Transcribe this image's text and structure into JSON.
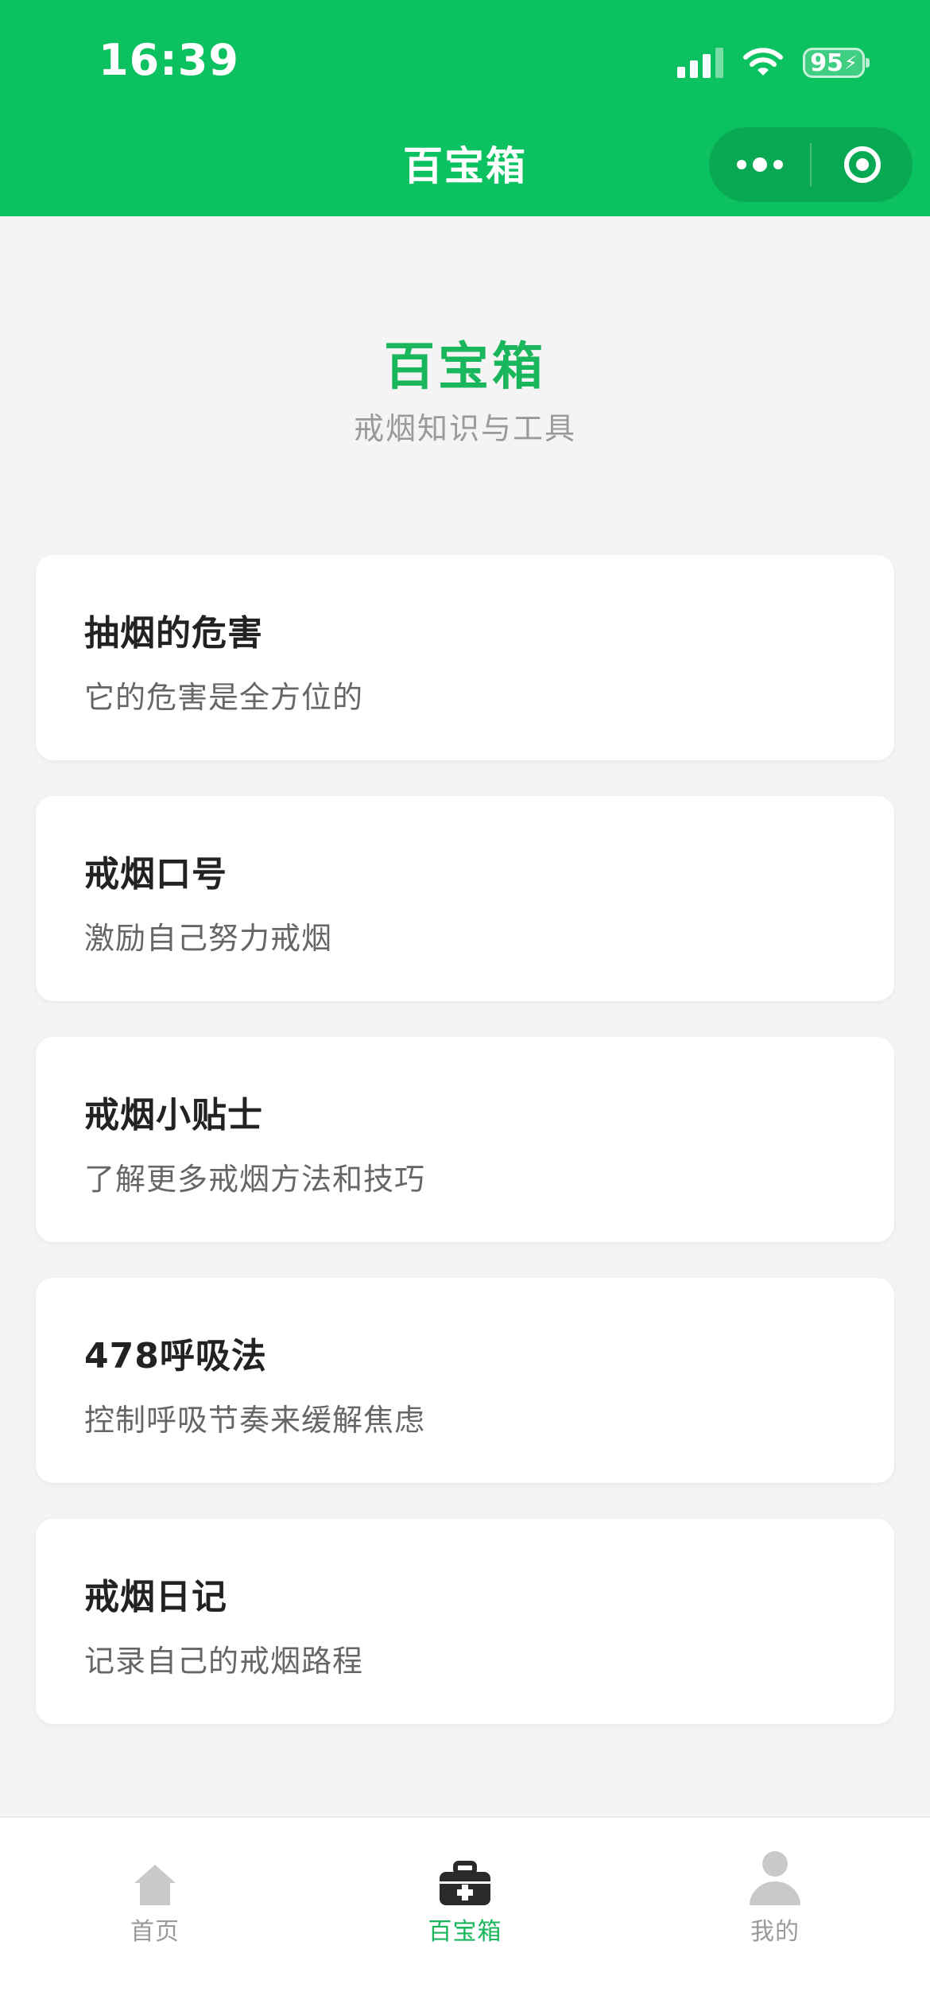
{
  "status_bar": {
    "time": "16:39",
    "battery": "95"
  },
  "nav": {
    "title": "百宝箱"
  },
  "hero": {
    "title": "百宝箱",
    "subtitle": "戒烟知识与工具"
  },
  "cards": [
    {
      "title": "抽烟的危害",
      "desc": "它的危害是全方位的"
    },
    {
      "title": "戒烟口号",
      "desc": "激励自己努力戒烟"
    },
    {
      "title": "戒烟小贴士",
      "desc": "了解更多戒烟方法和技巧"
    },
    {
      "title": "478呼吸法",
      "desc": "控制呼吸节奏来缓解焦虑"
    },
    {
      "title": "戒烟日记",
      "desc": "记录自己的戒烟路程"
    }
  ],
  "tabbar": {
    "items": [
      {
        "label": "首页",
        "icon": "home-icon",
        "active": false
      },
      {
        "label": "百宝箱",
        "icon": "toolbox-icon",
        "active": true
      },
      {
        "label": "我的",
        "icon": "user-icon",
        "active": false
      }
    ]
  },
  "colors": {
    "brand_green": "#0bc160",
    "title_green": "#19b65c",
    "background": "#f4f4f4",
    "inactive_tab": "#9a9a9a"
  }
}
